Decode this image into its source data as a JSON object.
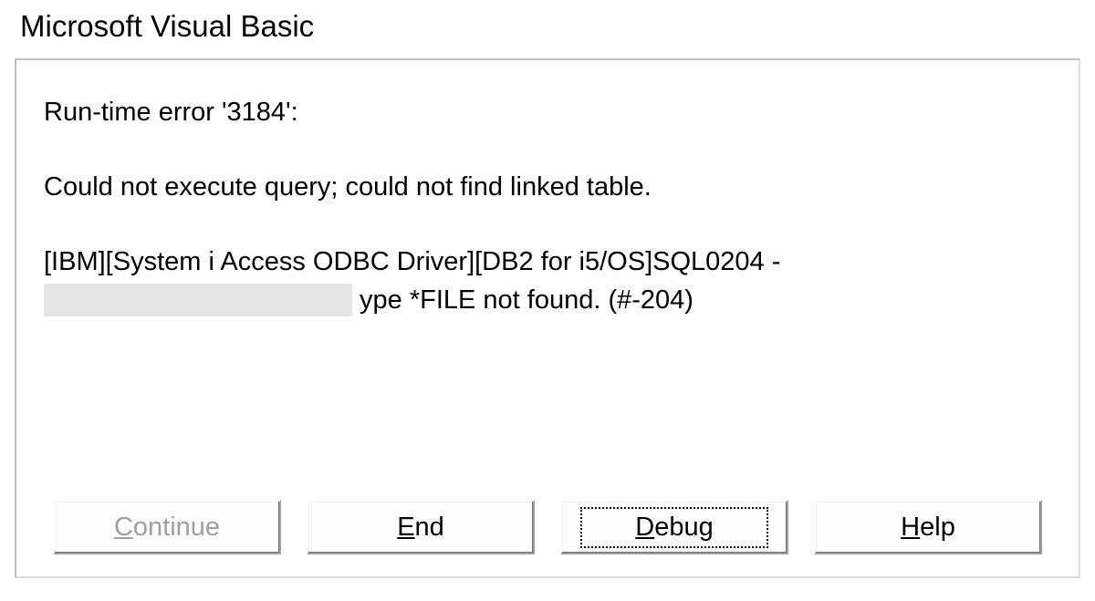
{
  "window": {
    "title": "Microsoft Visual Basic"
  },
  "error": {
    "headline": "Run-time error '3184':",
    "desc": "Could not execute query; could not find linked table.",
    "detail_line1": "[IBM][System i Access ODBC Driver][DB2 for i5/OS]SQL0204 -",
    "detail_line2_suffix": "ype *FILE not found. (#-204)"
  },
  "buttons": {
    "continue": {
      "prefix": "C",
      "rest": "ontinue"
    },
    "end": {
      "prefix": "E",
      "rest": "nd"
    },
    "debug": {
      "prefix": "D",
      "rest": "ebug"
    },
    "help": {
      "prefix": "H",
      "rest": "elp"
    }
  }
}
